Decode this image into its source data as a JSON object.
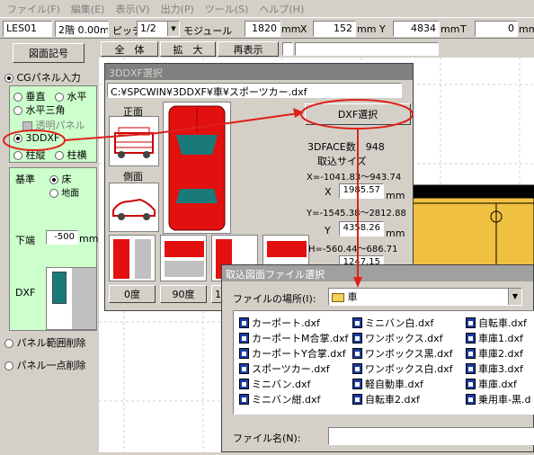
{
  "menu": [
    "ファイル(F)",
    "編集(E)",
    "表示(V)",
    "出力(P)",
    "ツール(S)",
    "ヘルプ(H)"
  ],
  "toolbar": {
    "layer": "LES01",
    "floor": "2階 0.00m²",
    "pitch_label": "ピッチ",
    "pitch_value": "1/2",
    "module_label": "モジュール",
    "module_value": "1820",
    "unit_mm": "mm",
    "x_label": "X",
    "x_value": "152",
    "y_label": "Y",
    "y_value": "4834",
    "t_label": "T",
    "t_value": "0"
  },
  "left": {
    "zumen_button": "図面記号",
    "cg_radio": "CGパネル入力",
    "vertical": "垂直",
    "horizontal": "水平",
    "horiz_triangle": "水平三角",
    "transparent": "透明パネル",
    "dxf3d": "3DDXF",
    "col_vertical": "柱縦",
    "col_horizontal": "柱横",
    "base_label": "基準",
    "floor_opt": "床",
    "ground_opt": "地面",
    "lower_label": "下端",
    "lower_value": "-500",
    "lower_unit": "mm",
    "dxf_label": "DXF",
    "panel_range_delete": "パネル範囲削除",
    "panel_point_delete": "パネル一点削除"
  },
  "viewbar": {
    "all": "全　体",
    "zoom": "拡　大",
    "redraw": "再表示"
  },
  "dxf_dialog": {
    "title": "3DDXF選択",
    "path": "C:¥SPCWIN¥3DDXF¥車¥スポーツカー.dxf",
    "front_label": "正面",
    "side_label": "側面",
    "select_button": "DXF選択",
    "face_count": "3DFACE数　948",
    "import_size": "取込サイズ",
    "x_range": "X=-1041.83～943.74",
    "x_label": "X",
    "x_value": "1985.57",
    "y_range": "Y=-1545.38～2812.88",
    "y_label": "Y",
    "y_value": "4358.26",
    "h_range": "H=-560.44～686.71",
    "h_value": "1247.15",
    "unit": "mm",
    "angle0": "0度",
    "angle90": "90度",
    "angle_more": "1"
  },
  "file_dialog": {
    "title": "取込図面ファイル選択",
    "location_label": "ファイルの場所(I):",
    "location_value": "車",
    "filename_label": "ファイル名(N):",
    "files": [
      [
        "カーポート.dxf",
        "カーポートM合掌.dxf",
        "カーポートY合掌.dxf",
        "スポーツカー.dxf",
        "ミニバン.dxf",
        "ミニバン紺.dxf"
      ],
      [
        "ミニバン白.dxf",
        "ワンボックス.dxf",
        "ワンボックス黒.dxf",
        "ワンボックス白.dxf",
        "軽自動車.dxf",
        "自転車2.dxf"
      ],
      [
        "自転車.dxf",
        "車庫1.dxf",
        "車庫2.dxf",
        "車庫3.dxf",
        "車庫.dxf",
        "乗用車-黒.d"
      ]
    ]
  },
  "colors": {
    "annotation_red": "#e0201a",
    "panel_green": "#ccffcc",
    "car_red": "#e31010",
    "car_teal": "#1a7a7a",
    "floor_yellow": "#f0c040"
  }
}
